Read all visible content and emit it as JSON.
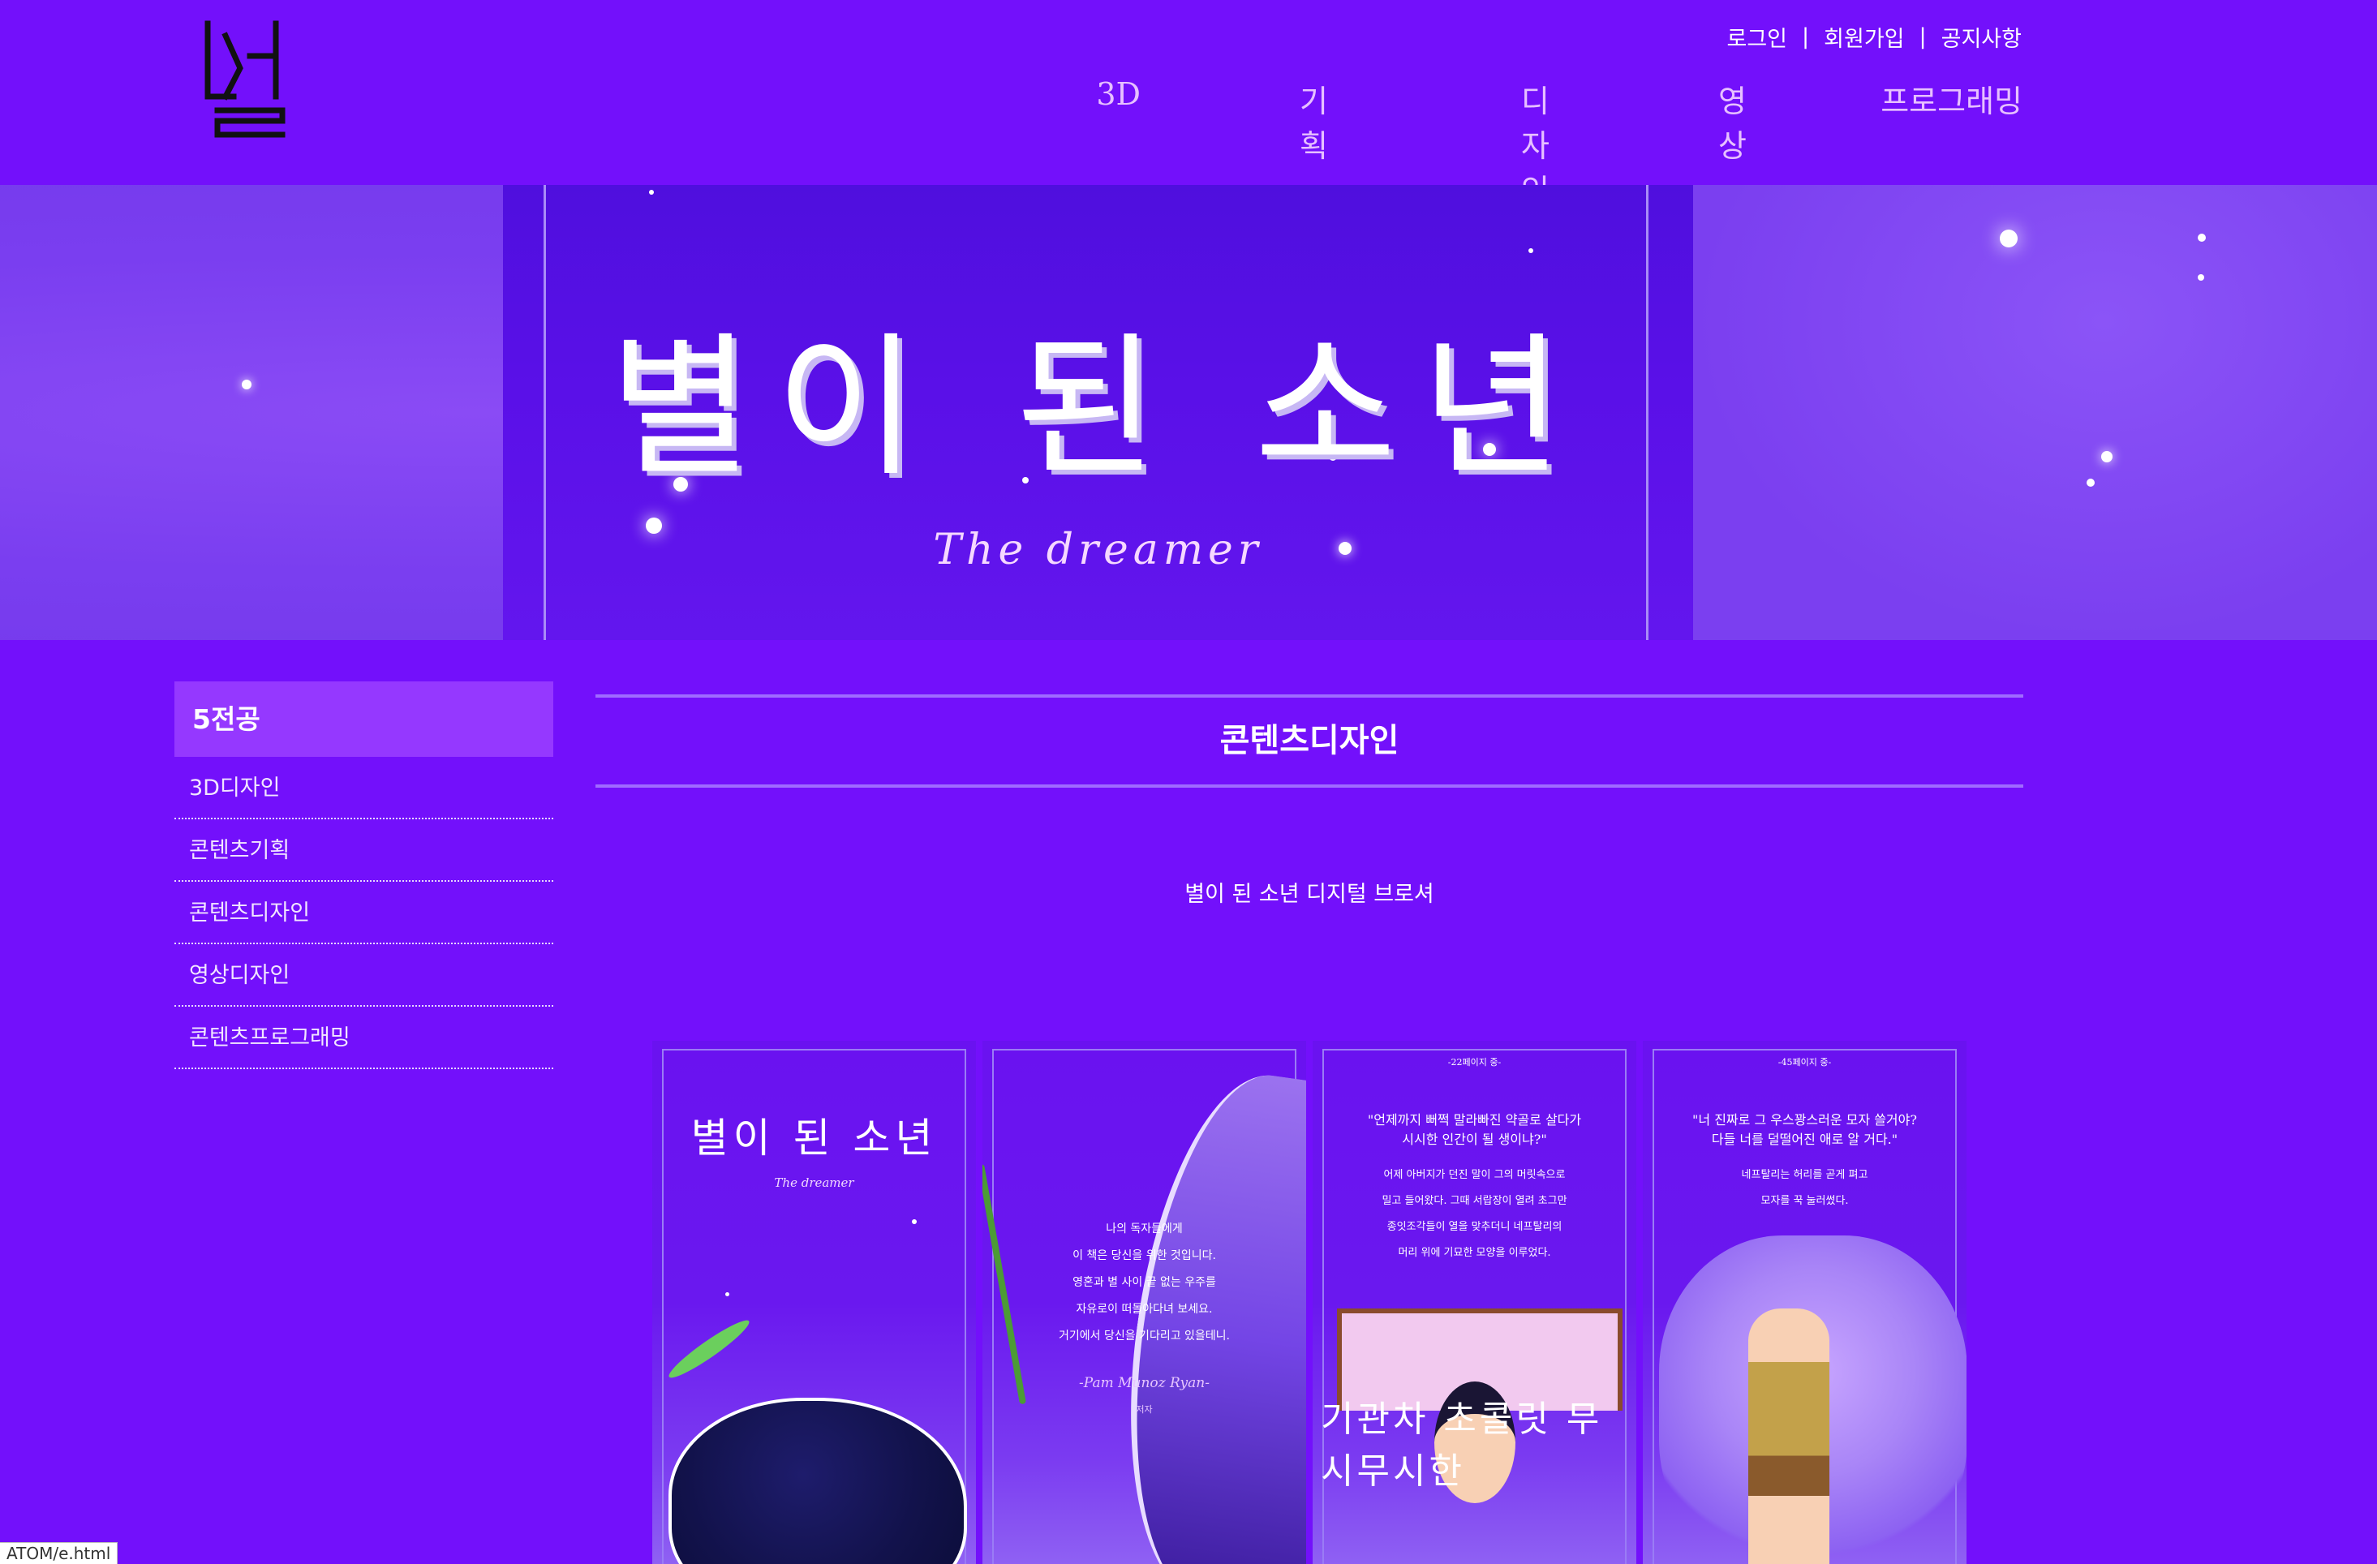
{
  "header": {
    "logo_text": "설",
    "util": [
      "로그인",
      "회원가입",
      "공지사항"
    ],
    "separator": "|",
    "nav": [
      "3D",
      "기획",
      "디자인",
      "영상",
      "프로그래밍"
    ]
  },
  "banner": {
    "title": "별이 된 소년",
    "subtitle": "The dreamer"
  },
  "sidebar": {
    "heading": "5전공",
    "items": [
      "3D디자인",
      "콘텐츠기획",
      "콘텐츠디자인",
      "영상디자인",
      "콘텐츠프로그래밍"
    ]
  },
  "content": {
    "title": "콘텐츠디자인",
    "description": "별이 된 소년 디지털 브로셔"
  },
  "brochure": {
    "panel1": {
      "title": "별이 된 소년",
      "subtitle": "The dreamer"
    },
    "panel2": {
      "poem": [
        "나의 독자들에게",
        "이 책은 당신을 위한 것입니다.",
        "영혼과 별 사이 끝 없는 우주를",
        "자유로이 떠돌아다녀 보세요.",
        "거기에서 당신을 기다리고 있을테니."
      ],
      "author": "-Pam Munoz Ryan-",
      "author_role": "저자"
    },
    "panel3": {
      "page": "-22페이지 중-",
      "quote": [
        "\"언제까지 뻐쩍 말라빠진 약골로 살다가",
        "시시한 인간이 될 생이냐?\""
      ],
      "body": [
        "어제 아버지가 던진 말이 그의 머릿속으로",
        "밀고 들어왔다. 그때 서랍장이 열려 초그만",
        "종잇조각들이 열을 맞추더니 네프탈리의",
        "머리 위에 기묘한 모양을 이루었다."
      ],
      "caption": "기관차 초콜릿 무시무시한"
    },
    "panel4": {
      "page": "-45페이지 중-",
      "quote": [
        "\"너 진짜로 그 우스꽝스러운 모자 쓸거야?",
        "다들 너를 덜떨어진 애로 알 거다.\""
      ],
      "body": [
        "네프탈리는 허리를 곧게 펴고",
        "모자를 꾹 눌러썼다."
      ]
    }
  },
  "statusbar": {
    "text": "ATOM/e.html"
  },
  "colors": {
    "background": "#7310fb",
    "sidebar_head": "#9538ff",
    "nav_text": "#e7c0ff"
  }
}
